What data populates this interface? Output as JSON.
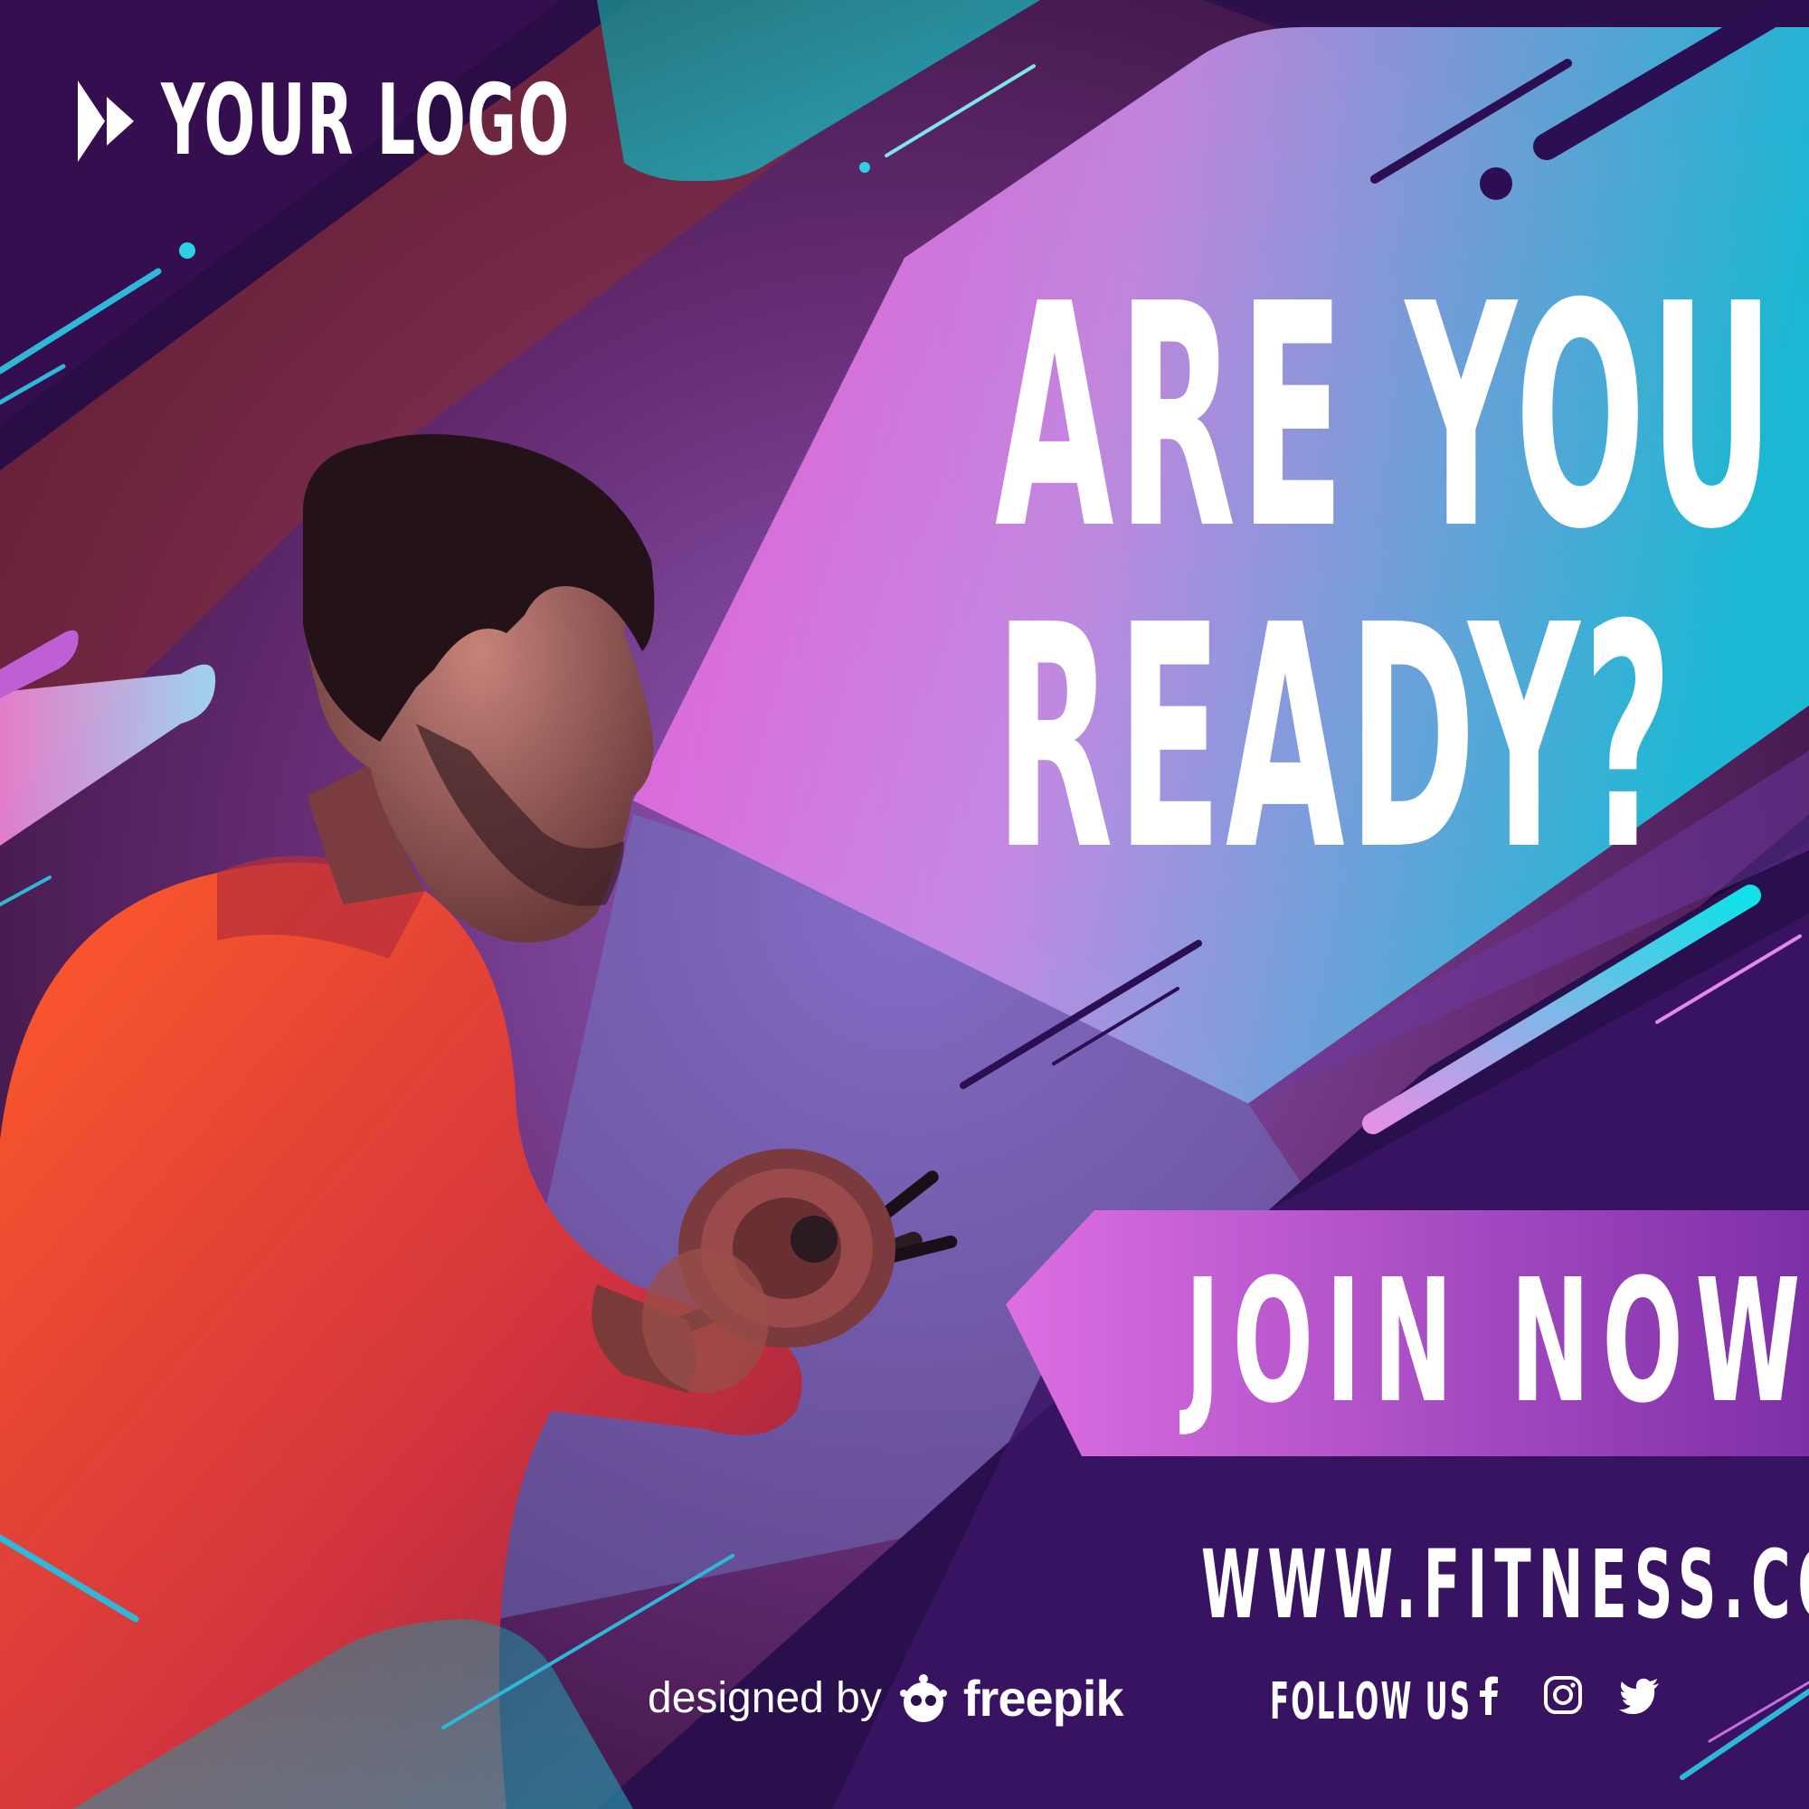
{
  "brand": {
    "logo_text": "YOUR LOGO",
    "logo_icon": "fast-forward-icon"
  },
  "headline": {
    "line1": "ARE YOU",
    "line2": "READY?"
  },
  "cta": {
    "label": "JOIN NOW"
  },
  "website": "WWW.FITNESS.COM",
  "credit": {
    "prefix": "designed by",
    "brand": "freepik",
    "icon": "freepik-mascot-icon"
  },
  "social": {
    "label": "FOLLOW US",
    "icons": [
      "facebook-icon",
      "instagram-icon",
      "twitter-icon"
    ]
  },
  "photo": {
    "subject": "man-lifting-dumbbell-icon"
  },
  "colors": {
    "background": "#1c0a33",
    "magenta": "#ea62e0",
    "cyan": "#18c7e0",
    "purple_dark": "#2a0f4d",
    "cta_left": "#d86ce0",
    "cta_right": "#7a30a8",
    "text": "#ffffff"
  }
}
